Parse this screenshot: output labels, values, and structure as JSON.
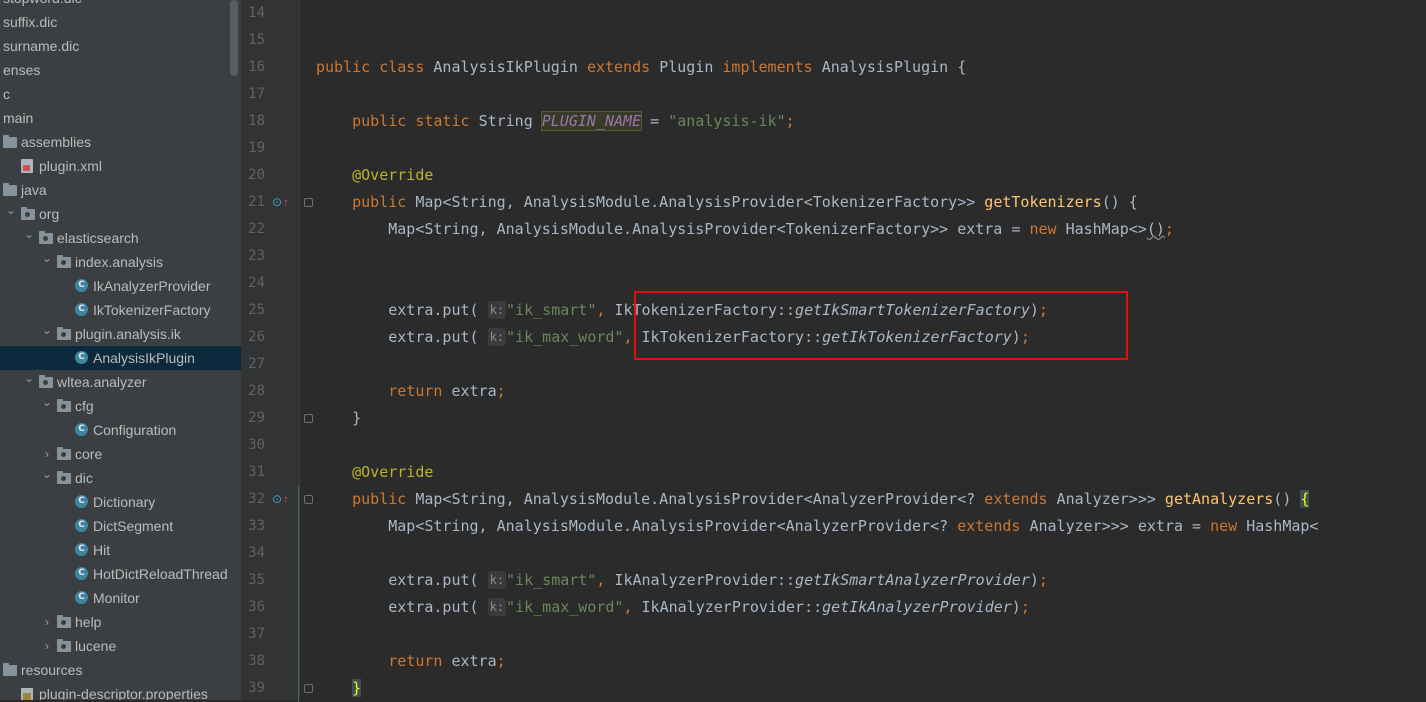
{
  "tree": {
    "items": [
      {
        "label": "stopword.dic",
        "icon": "dic-file-icon",
        "depth": 0,
        "arrow": "",
        "selected": false
      },
      {
        "label": "suffix.dic",
        "icon": "dic-file-icon",
        "depth": 0,
        "arrow": "",
        "selected": false
      },
      {
        "label": "surname.dic",
        "icon": "dic-file-icon",
        "depth": 0,
        "arrow": "",
        "selected": false
      },
      {
        "label": "enses",
        "icon": "",
        "depth": 0,
        "arrow": "",
        "selected": false
      },
      {
        "label": "c",
        "icon": "",
        "depth": 0,
        "arrow": "",
        "selected": false
      },
      {
        "label": "main",
        "icon": "",
        "depth": 0,
        "arrow": "",
        "selected": false
      },
      {
        "label": "assemblies",
        "icon": "folder-icon",
        "depth": 0,
        "arrow": "",
        "selected": false
      },
      {
        "label": "plugin.xml",
        "icon": "xml-file-icon",
        "depth": 1,
        "arrow": "",
        "selected": false
      },
      {
        "label": "java",
        "icon": "folder-icon",
        "depth": 0,
        "arrow": "",
        "selected": false
      },
      {
        "label": "org",
        "icon": "package-icon",
        "depth": 1,
        "arrow": "expanded",
        "selected": false
      },
      {
        "label": "elasticsearch",
        "icon": "package-icon",
        "depth": 2,
        "arrow": "expanded",
        "selected": false
      },
      {
        "label": "index.analysis",
        "icon": "package-icon",
        "depth": 3,
        "arrow": "expanded",
        "selected": false
      },
      {
        "label": "IkAnalyzerProvider",
        "icon": "class-icon",
        "depth": 4,
        "arrow": "",
        "selected": false
      },
      {
        "label": "IkTokenizerFactory",
        "icon": "class-icon",
        "depth": 4,
        "arrow": "",
        "selected": false
      },
      {
        "label": "plugin.analysis.ik",
        "icon": "package-icon",
        "depth": 3,
        "arrow": "expanded",
        "selected": false
      },
      {
        "label": "AnalysisIkPlugin",
        "icon": "class-icon",
        "depth": 4,
        "arrow": "",
        "selected": true
      },
      {
        "label": "wltea.analyzer",
        "icon": "package-icon",
        "depth": 2,
        "arrow": "expanded",
        "selected": false
      },
      {
        "label": "cfg",
        "icon": "package-icon",
        "depth": 3,
        "arrow": "expanded",
        "selected": false
      },
      {
        "label": "Configuration",
        "icon": "class-icon",
        "depth": 4,
        "arrow": "",
        "selected": false
      },
      {
        "label": "core",
        "icon": "package-icon",
        "depth": 3,
        "arrow": "collapsed",
        "selected": false
      },
      {
        "label": "dic",
        "icon": "package-icon",
        "depth": 3,
        "arrow": "expanded",
        "selected": false
      },
      {
        "label": "Dictionary",
        "icon": "class-icon",
        "depth": 4,
        "arrow": "",
        "selected": false
      },
      {
        "label": "DictSegment",
        "icon": "class-icon",
        "depth": 4,
        "arrow": "",
        "selected": false
      },
      {
        "label": "Hit",
        "icon": "class-icon",
        "depth": 4,
        "arrow": "",
        "selected": false
      },
      {
        "label": "HotDictReloadThread",
        "icon": "class-icon",
        "depth": 4,
        "arrow": "",
        "selected": false
      },
      {
        "label": "Monitor",
        "icon": "class-icon",
        "depth": 4,
        "arrow": "",
        "selected": false
      },
      {
        "label": "help",
        "icon": "package-icon",
        "depth": 3,
        "arrow": "collapsed",
        "selected": false
      },
      {
        "label": "lucene",
        "icon": "package-icon",
        "depth": 3,
        "arrow": "collapsed",
        "selected": false
      },
      {
        "label": "resources",
        "icon": "folder-icon",
        "depth": 0,
        "arrow": "",
        "selected": false
      },
      {
        "label": "plugin-descriptor.properties",
        "icon": "properties-file-icon",
        "depth": 1,
        "arrow": "",
        "selected": false
      }
    ]
  },
  "editor": {
    "line_numbers": [
      "14",
      "15",
      "16",
      "17",
      "18",
      "19",
      "20",
      "21",
      "22",
      "23",
      "24",
      "25",
      "26",
      "27",
      "28",
      "29",
      "30",
      "31",
      "32",
      "33",
      "34",
      "35",
      "36",
      "37",
      "38",
      "39"
    ],
    "gutter_markers": [
      {
        "line": "21",
        "icons": [
          "override-marker-icon",
          "implements-arrow-icon"
        ]
      },
      {
        "line": "32",
        "icons": [
          "override-marker-icon",
          "implements-arrow-icon"
        ]
      }
    ],
    "lines": [
      [],
      [],
      [
        {
          "t": "public ",
          "c": "kw"
        },
        {
          "t": "class ",
          "c": "kw"
        },
        {
          "t": "AnalysisIkPlugin "
        },
        {
          "t": "extends ",
          "c": "kw"
        },
        {
          "t": "Plugin "
        },
        {
          "t": "implements ",
          "c": "kw"
        },
        {
          "t": "AnalysisPlugin {"
        }
      ],
      [],
      [
        {
          "t": "    "
        },
        {
          "t": "public ",
          "c": "kw"
        },
        {
          "t": "static ",
          "c": "kw"
        },
        {
          "t": "String "
        },
        {
          "t": "PLUGIN_NAME",
          "c": "const"
        },
        {
          "t": " = "
        },
        {
          "t": "\"analysis-ik\"",
          "c": "str"
        },
        {
          "t": ";",
          "c": "kw"
        }
      ],
      [],
      [
        {
          "t": "    "
        },
        {
          "t": "@Override",
          "c": "ann"
        }
      ],
      [
        {
          "t": "    "
        },
        {
          "t": "public ",
          "c": "kw"
        },
        {
          "t": "Map<String, AnalysisModule.AnalysisProvider<TokenizerFactory>> "
        },
        {
          "t": "getTokenizers",
          "c": "fn"
        },
        {
          "t": "() {"
        }
      ],
      [
        {
          "t": "        "
        },
        {
          "t": "Map<String, AnalysisModule.AnalysisProvider<TokenizerFactory>> extra = "
        },
        {
          "t": "new ",
          "c": "kw"
        },
        {
          "t": "HashMap<>"
        },
        {
          "t": "()",
          "c": "squig"
        },
        {
          "t": ";",
          "c": "kw"
        }
      ],
      [],
      [],
      [
        {
          "t": "        "
        },
        {
          "t": "extra.put( "
        },
        {
          "t": "k:",
          "c": "hint"
        },
        {
          "t": "\"ik_smart\"",
          "c": "str"
        },
        {
          "t": ", ",
          "c": "kw"
        },
        {
          "t": "IkTokenizerFactory::"
        },
        {
          "t": "getIkSmartTokenizerFactory",
          "c": "ital"
        },
        {
          "t": ")"
        },
        {
          "t": ";",
          "c": "kw"
        }
      ],
      [
        {
          "t": "        "
        },
        {
          "t": "extra.put( "
        },
        {
          "t": "k:",
          "c": "hint"
        },
        {
          "t": "\"ik_max_word\"",
          "c": "str"
        },
        {
          "t": ", ",
          "c": "kw"
        },
        {
          "t": "IkTokenizerFactory::"
        },
        {
          "t": "getIkTokenizerFactory",
          "c": "ital"
        },
        {
          "t": ")"
        },
        {
          "t": ";",
          "c": "kw"
        }
      ],
      [],
      [
        {
          "t": "        "
        },
        {
          "t": "return ",
          "c": "kw"
        },
        {
          "t": "extra"
        },
        {
          "t": ";",
          "c": "kw"
        }
      ],
      [
        {
          "t": "    }"
        }
      ],
      [],
      [
        {
          "t": "    "
        },
        {
          "t": "@Override",
          "c": "ann"
        }
      ],
      [
        {
          "t": "    "
        },
        {
          "t": "public ",
          "c": "kw"
        },
        {
          "t": "Map<String, AnalysisModule.AnalysisProvider<AnalyzerProvider<? "
        },
        {
          "t": "extends ",
          "c": "kw"
        },
        {
          "t": "Analyzer>>> "
        },
        {
          "t": "getAnalyzers",
          "c": "fn"
        },
        {
          "t": "() "
        },
        {
          "t": "{",
          "c": "brace-hl"
        }
      ],
      [
        {
          "t": "        "
        },
        {
          "t": "Map<String, AnalysisModule.AnalysisProvider<AnalyzerProvider<? "
        },
        {
          "t": "extends ",
          "c": "kw"
        },
        {
          "t": "Analyzer>>> extra = "
        },
        {
          "t": "new ",
          "c": "kw"
        },
        {
          "t": "HashMap<"
        }
      ],
      [],
      [
        {
          "t": "        "
        },
        {
          "t": "extra.put( "
        },
        {
          "t": "k:",
          "c": "hint"
        },
        {
          "t": "\"ik_smart\"",
          "c": "str"
        },
        {
          "t": ", ",
          "c": "kw"
        },
        {
          "t": "IkAnalyzerProvider::"
        },
        {
          "t": "getIkSmartAnalyzerProvider",
          "c": "ital"
        },
        {
          "t": ")"
        },
        {
          "t": ";",
          "c": "kw"
        }
      ],
      [
        {
          "t": "        "
        },
        {
          "t": "extra.put( "
        },
        {
          "t": "k:",
          "c": "hint"
        },
        {
          "t": "\"ik_max_word\"",
          "c": "str"
        },
        {
          "t": ", ",
          "c": "kw"
        },
        {
          "t": "IkAnalyzerProvider::"
        },
        {
          "t": "getIkAnalyzerProvider",
          "c": "ital"
        },
        {
          "t": ")"
        },
        {
          "t": ";",
          "c": "kw"
        }
      ],
      [],
      [
        {
          "t": "        "
        },
        {
          "t": "return ",
          "c": "kw"
        },
        {
          "t": "extra"
        },
        {
          "t": ";",
          "c": "kw"
        }
      ],
      [
        {
          "t": "    "
        },
        {
          "t": "}",
          "c": "brace-hl"
        }
      ]
    ]
  },
  "colors": {
    "keyword": "#cc7832",
    "string": "#6a8759",
    "annotation": "#bbb529",
    "method_decl": "#ffc66d",
    "constant": "#9876aa",
    "default_text": "#a9b7c6",
    "selection": "#0d293e",
    "annotation_box": "#e01010"
  }
}
